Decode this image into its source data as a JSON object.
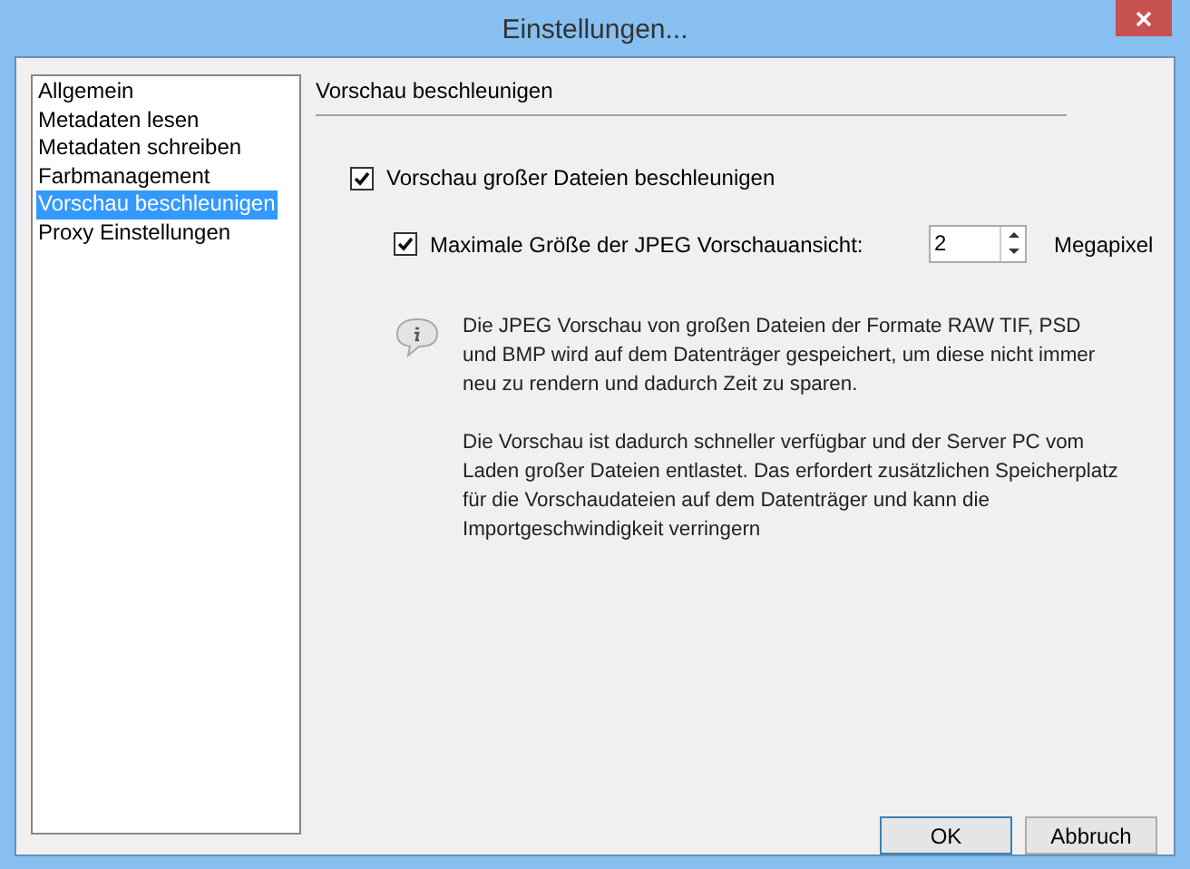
{
  "window": {
    "title": "Einstellungen..."
  },
  "sidebar": {
    "items": [
      {
        "label": "Allgemein",
        "selected": false
      },
      {
        "label": "Metadaten lesen",
        "selected": false
      },
      {
        "label": "Metadaten schreiben",
        "selected": false
      },
      {
        "label": "Farbmanagement",
        "selected": false
      },
      {
        "label": "Vorschau beschleunigen",
        "selected": true
      },
      {
        "label": "Proxy Einstellungen",
        "selected": false
      }
    ]
  },
  "section_title": "Vorschau beschleunigen",
  "accelerate": {
    "label": "Vorschau großer Dateien beschleunigen",
    "checked": true
  },
  "max_size": {
    "label": "Maximale Größe der JPEG Vorschauansicht:",
    "checked": true,
    "value": "2",
    "unit": "Megapixel"
  },
  "info": [
    "Die JPEG Vorschau von großen Dateien der Formate RAW TIF, PSD und BMP wird auf dem Datenträger gespeichert, um diese nicht immer neu zu rendern und dadurch Zeit zu sparen.",
    "Die Vorschau ist dadurch schneller verfügbar und der Server PC vom Laden großer Dateien entlastet. Das erfordert zusätzlichen Speicherplatz für die Vorschaudateien auf dem Datenträger und kann die Importgeschwindigkeit verringern"
  ],
  "buttons": [
    {
      "label": "OK",
      "selected": true
    },
    {
      "label": "Abbruch",
      "selected": false
    }
  ]
}
